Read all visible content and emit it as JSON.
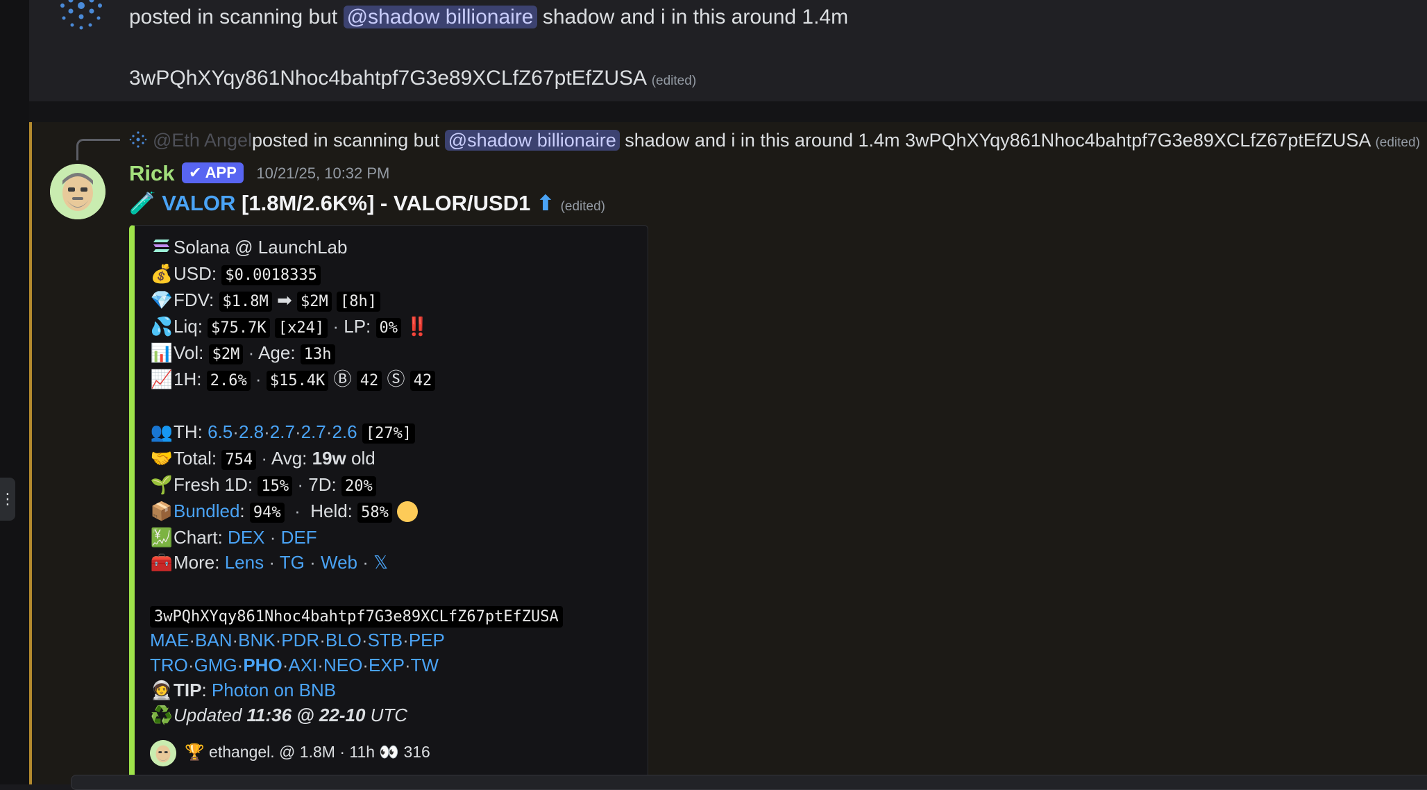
{
  "message1": {
    "line1_pre": "posted in scanning but ",
    "mention": "@shadow billionaire",
    "line1_post": " shadow and i in this around 1.4m",
    "line2": "3wPQhXYqy861Nhoc4bahtpf7G3e89XCLfZ67ptEfZUSA",
    "edited": "(edited)"
  },
  "reply": {
    "author": "@Eth Angel",
    "text_pre": "posted in scanning but ",
    "mention": "@shadow billionaire",
    "text_post": " shadow and i in this around 1.4m   3wPQhXYqy861Nhoc4bahtpf7G3e89XCLfZ67ptEfZUSA",
    "edited": "(edited)"
  },
  "message2": {
    "author": "Rick",
    "badge": "✔ APP",
    "timestamp": "10/21/25, 10:32 PM",
    "title_emoji": "🧪",
    "title_token": "VALOR",
    "title_rest": " [1.8M/2.6K%] - VALOR/USD1",
    "title_arrow": "⬆",
    "edited": "(edited)"
  },
  "embed": {
    "chain": "Solana @ LaunchLab",
    "usd_label": "USD:",
    "usd_value": "$0.0018335",
    "fdv_label": "FDV:",
    "fdv_from": "$1.8M",
    "fdv_arrow": "➡",
    "fdv_to": "$2M",
    "fdv_time": "[8h]",
    "liq_label": "Liq:",
    "liq_value": "$75.7K",
    "liq_mult": "[x24]",
    "lp_label": "LP:",
    "lp_value": "0%",
    "lp_warn": "‼️",
    "vol_label": "Vol:",
    "vol_value": "$2M",
    "age_label": "Age:",
    "age_value": "13h",
    "h1_label": "1H:",
    "h1_pct": "2.6%",
    "h1_usd": "$15.4K",
    "buy_icon": "Ⓑ",
    "buy_count": "42",
    "sell_icon": "Ⓢ",
    "sell_count": "42",
    "th_label": "TH:",
    "th_values": [
      "6.5",
      "2.8",
      "2.7",
      "2.7",
      "2.6"
    ],
    "th_total": "[27%]",
    "total_label": "Total:",
    "total_value": "754",
    "avg_label": "Avg:",
    "avg_value": "19w",
    "avg_suffix": "old",
    "fresh_label": "Fresh 1D:",
    "fresh_1d": "15%",
    "fresh_7d_label": "7D:",
    "fresh_7d": "20%",
    "bundled_link": "Bundled",
    "bundled_value": "94%",
    "held_label": "Held:",
    "held_value": "58%",
    "chart_label": "Chart:",
    "chart_links": [
      "DEX",
      "DEF"
    ],
    "more_label": "More:",
    "more_links": [
      "Lens",
      "TG",
      "Web",
      "𝕏"
    ],
    "address": "3wPQhXYqy861Nhoc4bahtpf7G3e89XCLfZ67ptEfZUSA",
    "bots_row1": [
      "MAE",
      "BAN",
      "BNK",
      "PDR",
      "BLO",
      "STB",
      "PEP"
    ],
    "bots_row2": [
      "TRO",
      "GMG",
      "PHO",
      "AXI",
      "NEO",
      "EXP",
      "TW"
    ],
    "tip_label": "TIP",
    "tip_link": "Photon on BNB",
    "updated_pre": "Updated ",
    "updated_bold": "11:36 @ 22-10",
    "updated_post": " UTC",
    "footer": "🏆 ethangel. @ 1.8M · 11h 👀 316"
  },
  "colors": {
    "embed_accent": "#9ee34a",
    "link": "#4aa3f5",
    "author": "#a3e07c",
    "badge": "#5865f2",
    "mention_bg": "#3c4270"
  }
}
